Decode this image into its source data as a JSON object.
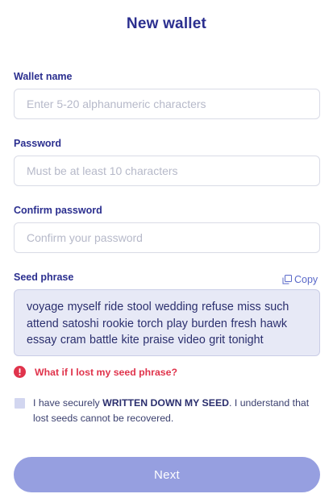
{
  "page": {
    "title": "New wallet"
  },
  "wallet_name": {
    "label": "Wallet name",
    "placeholder": "Enter 5-20 alphanumeric characters",
    "value": ""
  },
  "password": {
    "label": "Password",
    "placeholder": "Must be at least 10 characters",
    "value": ""
  },
  "confirm_password": {
    "label": "Confirm password",
    "placeholder": "Confirm your password",
    "value": ""
  },
  "seed": {
    "label": "Seed phrase",
    "copy_label": "Copy",
    "copy_icon": "copy-icon",
    "phrase": "voyage myself ride stool wedding refuse miss such attend satoshi rookie torch play burden fresh hawk essay cram battle kite praise video grit tonight"
  },
  "warning": {
    "icon": "alert-circle-icon",
    "text": "What if I lost my seed phrase?"
  },
  "consent": {
    "checked": false,
    "text_before": "I have securely ",
    "text_strong": "WRITTEN DOWN MY SEED",
    "text_after": ". I understand that lost seeds cannot be recovered."
  },
  "actions": {
    "next_label": "Next"
  },
  "colors": {
    "accent": "#2b2f8f",
    "link": "#5a69c9",
    "warning": "#e0344c",
    "button": "#969fe0",
    "seed_bg": "#e7e9f6"
  }
}
